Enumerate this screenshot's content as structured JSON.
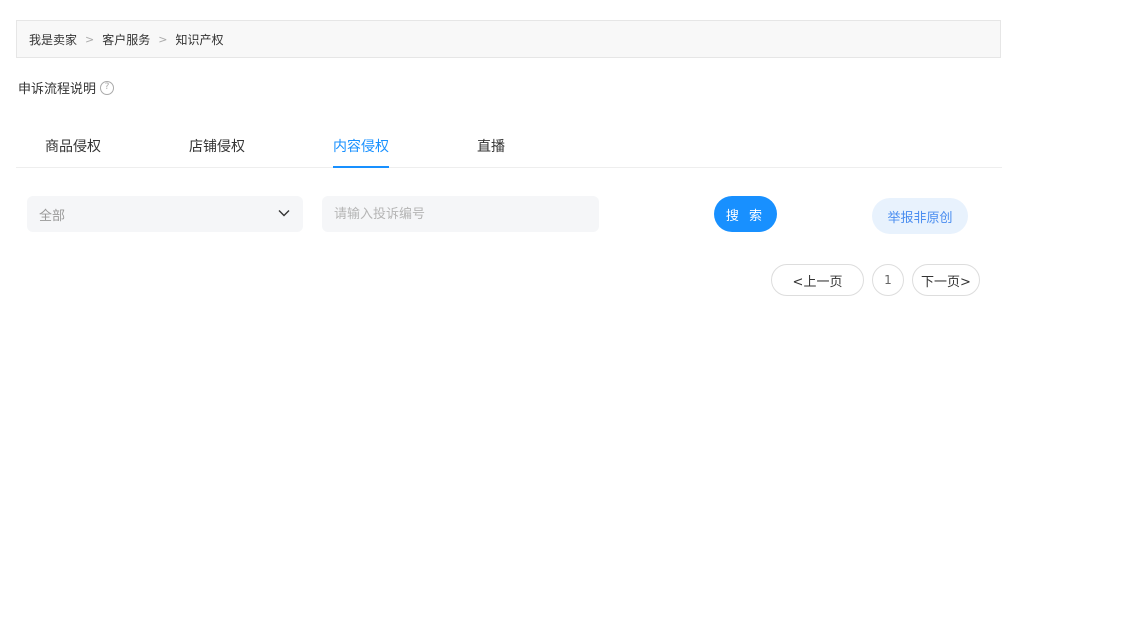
{
  "breadcrumb": {
    "items": [
      "我是卖家",
      "客户服务",
      "知识产权"
    ],
    "separator": ">"
  },
  "help": {
    "label": "申诉流程说明",
    "icon": "question-circle-icon"
  },
  "tabs": [
    {
      "label": "商品侵权",
      "active": false
    },
    {
      "label": "店铺侵权",
      "active": false
    },
    {
      "label": "内容侵权",
      "active": true
    },
    {
      "label": "直播",
      "active": false
    }
  ],
  "filters": {
    "status_select": {
      "value": "全部",
      "icon": "chevron-down-icon"
    },
    "complaint_input": {
      "value": "",
      "placeholder": "请输入投诉编号"
    },
    "search_label": "搜 索",
    "report_label": "举报非原创"
  },
  "pagination": {
    "prev_label": "<上一页",
    "current_page": "1",
    "next_label": "下一页>"
  },
  "colors": {
    "accent": "#1890ff",
    "report_bg": "#e8f2fd",
    "report_text": "#4a8df0"
  }
}
